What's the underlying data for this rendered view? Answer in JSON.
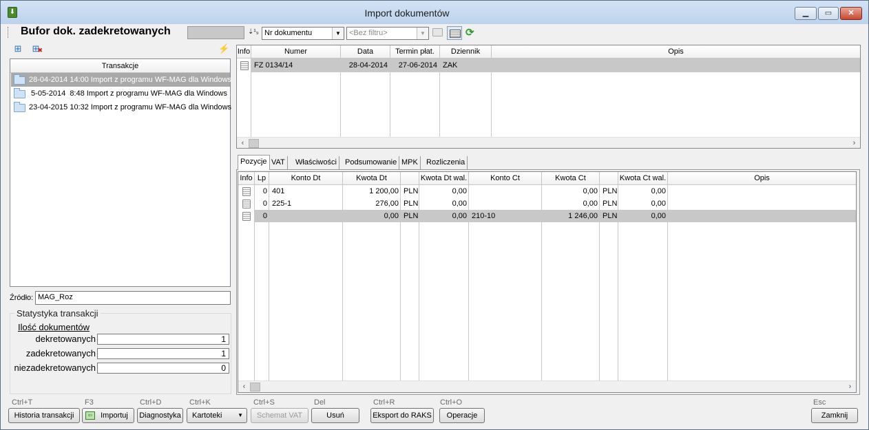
{
  "window": {
    "title": "Import dokumentów"
  },
  "toolbar": {
    "buffer_title": "Bufor dok. zadekretowanych",
    "sort_value": "Nr dokumentu",
    "filter_value": "<Bez filtru>"
  },
  "transactions": {
    "header": "Transakcje",
    "items": [
      "28-04-2014 14:00 Import z programu WF-MAG dla Windows",
      " 5-05-2014  8:48 Import z programu WF-MAG dla Windows",
      "23-04-2015 10:32 Import z programu WF-MAG dla Windows"
    ]
  },
  "source": {
    "label": "Źródło:",
    "value": "MAG_Roz"
  },
  "stats": {
    "title": "Statystyka transakcji",
    "doc_count_label": "Ilość dokumentów",
    "rows": [
      {
        "label": "dekretowanych",
        "value": "1"
      },
      {
        "label": "zadekretowanych",
        "value": "1"
      },
      {
        "label": "niezadekretowanych",
        "value": "0"
      }
    ]
  },
  "documents": {
    "headers": [
      "Info",
      "Numer",
      "Data",
      "Termin płat.",
      "Dziennik",
      "Opis"
    ],
    "rows": [
      {
        "numer": "FZ 0134/14",
        "data": "28-04-2014",
        "termin": "27-06-2014",
        "dziennik": "ZAK",
        "opis": ""
      }
    ]
  },
  "tabs": [
    "Pozycje",
    "VAT",
    "Właściwości",
    "Podsumowanie",
    "MPK",
    "Rozliczenia"
  ],
  "positions": {
    "headers": [
      "Info",
      "Lp",
      "Konto Dt",
      "Kwota Dt",
      "",
      "Kwota Dt wal.",
      "Konto Ct",
      "Kwota Ct",
      "",
      "Kwota Ct wal.",
      "Opis"
    ],
    "rows": [
      {
        "lp": "0",
        "konto_dt": "401",
        "kwota_dt": "1 200,00",
        "cur_dt": "PLN",
        "kwota_dt_wal": "0,00",
        "konto_ct": "",
        "kwota_ct": "0,00",
        "cur_ct": "PLN",
        "kwota_ct_wal": "0,00",
        "opis": ""
      },
      {
        "lp": "0",
        "konto_dt": "225-1",
        "kwota_dt": "276,00",
        "cur_dt": "PLN",
        "kwota_dt_wal": "0,00",
        "konto_ct": "",
        "kwota_ct": "0,00",
        "cur_ct": "PLN",
        "kwota_ct_wal": "0,00",
        "opis": ""
      },
      {
        "lp": "0",
        "konto_dt": "",
        "kwota_dt": "0,00",
        "cur_dt": "PLN",
        "kwota_dt_wal": "0,00",
        "konto_ct": "210-10",
        "kwota_ct": "1 246,00",
        "cur_ct": "PLN",
        "kwota_ct_wal": "0,00",
        "opis": ""
      }
    ]
  },
  "buttons": [
    {
      "shortcut": "Ctrl+T",
      "label": "Historia transakcji"
    },
    {
      "shortcut": "F3",
      "label": "Importuj"
    },
    {
      "shortcut": "Ctrl+D",
      "label": "Diagnostyka"
    },
    {
      "shortcut": "Ctrl+K",
      "label": "Kartoteki"
    },
    {
      "shortcut": "Ctrl+S",
      "label": "Schemat VAT"
    },
    {
      "shortcut": "Del",
      "label": "Usuń"
    },
    {
      "shortcut": "Ctrl+R",
      "label": "Eksport do RAKS"
    },
    {
      "shortcut": "Ctrl+O",
      "label": "Operacje"
    },
    {
      "shortcut": "Esc",
      "label": "Zamknij"
    }
  ]
}
